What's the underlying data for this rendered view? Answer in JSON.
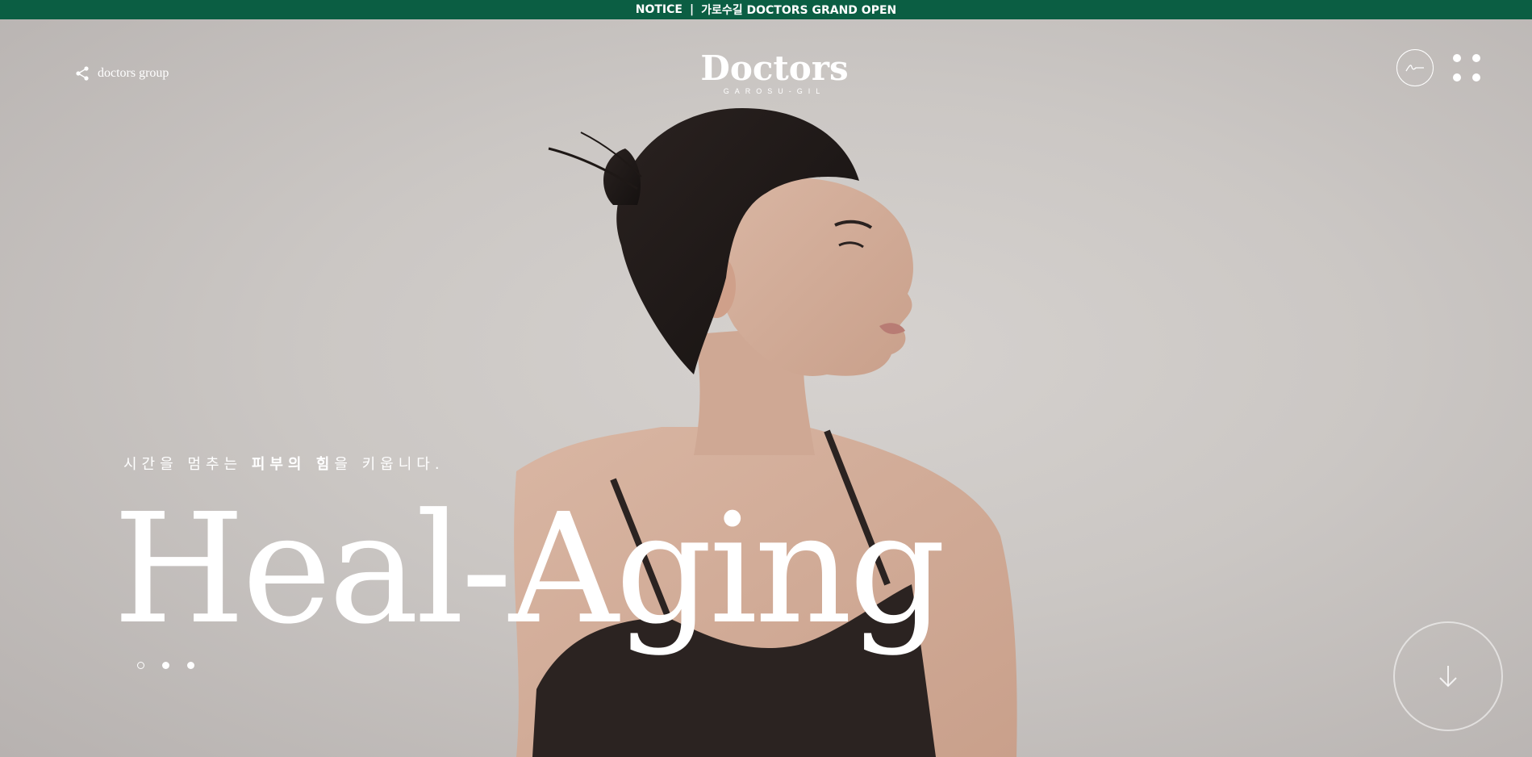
{
  "notice": {
    "label": "NOTICE",
    "separator": "|",
    "text": "가로수길 DOCTORS GRAND OPEN"
  },
  "header": {
    "group_link": "doctors group",
    "logo_main": "Doctors",
    "logo_sub": "GAROSU-GIL"
  },
  "hero": {
    "tagline_part1": "시간을 멈추는 ",
    "tagline_bold1": "피부의 힘",
    "tagline_part2": "을 키웁니다.",
    "headline": "Heal-Aging",
    "slides": 3,
    "active_slide": 1
  },
  "colors": {
    "notice_bg": "#0b5e43",
    "text": "#ffffff",
    "background": "#c9c5c2"
  },
  "icons": {
    "share": "share-icon",
    "signature": "signature-icon",
    "menu": "grid-dots-icon",
    "scroll": "arrow-down-icon"
  }
}
